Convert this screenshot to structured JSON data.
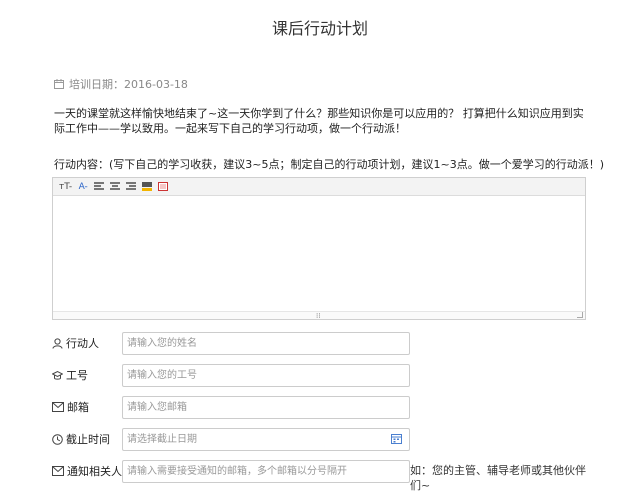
{
  "page": {
    "title": "课后行动计划"
  },
  "training_date": {
    "label": "培训日期：2016-03-18"
  },
  "intro": {
    "text": "一天的课堂就这样愉快地结束了~这一天你学到了什么？那些知识你是可以应用的？ 打算把什么知识应用到实际工作中——学以致用。一起来写下自己的学习行动项，做一个行动派！"
  },
  "action": {
    "label": "行动内容：(写下自己的学习收获，建议3~5点；制定自己的行动项计划，建议1~3点。做一个爱学习的行动派！)"
  },
  "toolbar": {
    "font_size": "тT-",
    "font_color": "A-",
    "icons": [
      "align-left-icon",
      "align-center-icon",
      "align-right-icon",
      "highlight-icon",
      "image-icon"
    ]
  },
  "form": {
    "actor": {
      "label": "行动人",
      "placeholder": "请输入您的姓名"
    },
    "job_no": {
      "label": "工号",
      "placeholder": "请输入您的工号"
    },
    "email": {
      "label": "邮箱",
      "placeholder": "请输入您邮箱"
    },
    "deadline": {
      "label": "截止时间",
      "placeholder": "请选择截止日期"
    },
    "notify": {
      "label": "通知相关人",
      "placeholder": "请输入需要接受通知的邮箱，多个邮箱以分号隔开",
      "hint": "如：您的主管、辅导老师或其他伙伴们~"
    }
  },
  "colors": {
    "accent": "#2a64c8",
    "border": "#cccccc"
  }
}
